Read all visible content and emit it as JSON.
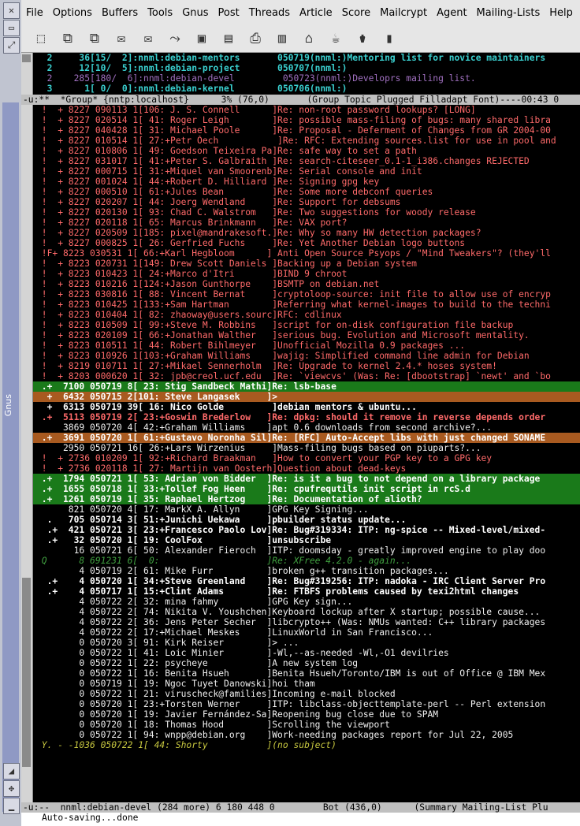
{
  "menubar": {
    "items": [
      "File",
      "Options",
      "Buffers",
      "Tools",
      "Gnus",
      "Post",
      "Threads",
      "Article",
      "Score",
      "Mailcrypt",
      "Agent",
      "Mailing-Lists",
      "Help"
    ]
  },
  "window_title": "Gnus",
  "toolbar": {
    "icons": [
      "exit-icon",
      "catch-up-icon",
      "catch-up-all-icon",
      "post-icon",
      "reply-icon",
      "forward-icon",
      "save-icon",
      "uudecode-icon",
      "print-icon",
      "copy-icon",
      "mark-icon",
      "kill-icon",
      "trash-icon",
      "prev-icon"
    ]
  },
  "group_buffer": {
    "lines": [
      {
        "text": "  2     36[15/  2]:nnml:debian-mentors       050719(nnml:)Mentoring list for novice maintainers",
        "style": "g-cyan",
        "marker": ""
      },
      {
        "text": "  2     12[10/  5]:nnml:debian-project       050707(nnml:)",
        "style": "g-cyan",
        "marker": ""
      },
      {
        "text": "  2    285[180/  6]:nnml:debian-devel         050723(nnml:)Developrs mailing list.",
        "style": "g-purple",
        "marker": "[]"
      },
      {
        "text": "  3      1[ 0/  0]:nnml:debian-kernel        050706(nnml:)",
        "style": "g-cyan",
        "marker": ""
      }
    ],
    "modeline": "-u:**  *Group* {nntp:localhost}      3% (76,0)       (Group Topic Plugged Filladapt Font)----00:43 0"
  },
  "summary_buffer": {
    "lines": [
      {
        "t": " !  + 8227 090113 1[106: J. S. Connell      ]Re: non-root password lookups? [LONG]",
        "s": "c-red"
      },
      {
        "t": " !  + 8227 020514 1[ 41: Roger Leigh        ]Re: possible mass-filing of bugs: many shared libra",
        "s": "c-red"
      },
      {
        "t": " !  + 8227 040428 1[ 31: Michael Poole      ]Re: Proposal - Deferment of Changes from GR 2004-00",
        "s": "c-red"
      },
      {
        "t": " !  + 8227 010514 1[ 27:+Petr Ŏech           ]Re: RFC: Extending sources.list for use in pool and",
        "s": "c-red"
      },
      {
        "t": " !  + 8227 010806 1[ 49: Goedson Teixeira Pa]Re: safe way to set a path",
        "s": "c-red"
      },
      {
        "t": " !  + 8227 031017 1[ 41:+Peter S. Galbraith ]Re: search-citeseer_0.1-1_i386.changes REJECTED",
        "s": "c-red"
      },
      {
        "t": " !  + 8227 000715 1[ 31:+Miquel van Smoorenb]Re: Serial console and init",
        "s": "c-red"
      },
      {
        "t": " !  + 8227 001024 1[ 44:+Robert D. Hilliard ]Re: Signing gpg key",
        "s": "c-red"
      },
      {
        "t": " !  + 8227 000510 1[ 61:+Jules Bean         ]Re: Some more debconf queries",
        "s": "c-red"
      },
      {
        "t": " !  + 8227 020207 1[ 44: Joerg Wendland     ]Re: Support for debsums",
        "s": "c-red"
      },
      {
        "t": " !  + 8227 020130 1[ 93: Chad C. Walstrom   ]Re: Two suggestions for woody release",
        "s": "c-red"
      },
      {
        "t": " !  + 8227 020118 1[ 65: Marcus Brinkmann   ]Re: VAX port?",
        "s": "c-red"
      },
      {
        "t": " !  + 8227 020509 1[185: pixel@mandrakesoft.]Re: Why so many HW detection packages?",
        "s": "c-red"
      },
      {
        "t": " !  + 8227 000825 1[ 26: Gerfried Fuchs     ]Re: Yet Another Debian logo buttons",
        "s": "c-red"
      },
      {
        "t": " !F+ 8223 030531 1[ 66:+Karl Hegbloom      ] Anti Open Source Psyops / \"Mind Tweakers\"? (they'll",
        "s": "c-red"
      },
      {
        "t": " !  + 8223 020731 1[149: Drew Scott Daniels ]Backing up a Debian system",
        "s": "c-red"
      },
      {
        "t": " !  + 8223 010423 1[ 24:+Marco d'Itri       ]BIND 9 chroot",
        "s": "c-red"
      },
      {
        "t": " !  + 8223 010216 1[124:+Jason Gunthorpe    ]BSMTP on debian.net",
        "s": "c-red"
      },
      {
        "t": " !  + 8223 030816 1[ 88: Vincent Bernat     ]cryptoloop-source: init file to allow use of encryp",
        "s": "c-red"
      },
      {
        "t": " !  + 8223 010425 1[133:+Sam Hartman        ]Referring what kernel-images to build to the techni",
        "s": "c-red"
      },
      {
        "t": " !  + 8223 010404 1[ 82: zhaoway@users.sourc]RFC: cdlinux",
        "s": "c-red"
      },
      {
        "t": " !  + 8223 010509 1[ 99:+Steve M. Robbins   ]script for on-disk configuration file backup",
        "s": "c-red"
      },
      {
        "t": " !  + 8223 020109 1[ 66:+Jonathan Walther   ]serious bug. Evolution and Microsoft mentality.",
        "s": "c-red"
      },
      {
        "t": " !  + 8223 010511 1[ 44: Robert Bihlmeyer   ]Unofficial Mozilla 0.9 packages ...",
        "s": "c-red"
      },
      {
        "t": " !  + 8223 010926 1[103:+Graham Williams    ]wajig: Simplified command line admin for Debian",
        "s": "c-red"
      },
      {
        "t": " !  + 8219 010711 1[ 27:+Mikael Sennerholm  ]Re: Upgrade to kernel 2.4.* hoses system!",
        "s": "c-red"
      },
      {
        "t": " !  + 8203 000620 1[ 32: jpb@creol.ucf.edu  ]Re: `viewcvs' (Was: Re: [dbootstrap] `newt' and `bo",
        "s": "c-red"
      },
      {
        "t": " .+  7100 050719 8[ 23: Stig Sandbeck Mathi]Re: lsb-base",
        "s": "hl-green"
      },
      {
        "t": "  +  6432 050715 2[101: Steve Langasek     ]>",
        "s": "hl-orange"
      },
      {
        "t": "  +  6313 050719 39[ 16: Nico Golde         ]debian mentors & ubuntu...",
        "s": "c-whitebold"
      },
      {
        "t": " .+  5113 050719 2[ 23:+Goswin Brederlow   ]Re: dpkg: should it remove in reverse depends order",
        "s": "c-bold"
      },
      {
        "t": "     3869 050720 4[ 42:+Graham Williams    ]apt 0.6 downloads from second archive?...",
        "s": "c-white"
      },
      {
        "t": " .+  3691 050720 1[ 61:+Gustavo Noronha Sil]Re: [RFC] Auto-Accept libs with just changed SONAME",
        "s": "hl-orange"
      },
      {
        "t": "     2950 050721 16[ 26:+Lars Wirzenius     ]Mass-filing bugs based on piuparts?...",
        "s": "c-white"
      },
      {
        "t": " !  + 2736 010209 1[ 92:+Richard Braakman   ]How to convert your PGP key to a GPG key",
        "s": "c-red"
      },
      {
        "t": " !  + 2736 020118 1[ 27: Martijn van Oosterh]Question about dead-keys",
        "s": "c-red"
      },
      {
        "t": " .+  1794 050721 1[ 53: Adrian von Bidder  ]Re: is it a bug to not depend on a library package",
        "s": "hl-green"
      },
      {
        "t": " .+  1655 050718 1[ 33:+Tollef Fog Heen    ]Re: cpufrequtils init script in rcS.d",
        "s": "hl-green"
      },
      {
        "t": " .+  1261 050719 1[ 35: Raphael Hertzog    ]Re: Documentation of alioth?",
        "s": "hl-green"
      },
      {
        "t": "      821 050720 4[ 17: MarkX A. Allyn     ]GPG Key Signing...",
        "s": "c-white"
      },
      {
        "t": "  .   705 050714 3[ 51:+Junichi Uekawa     ]pbuilder status update...",
        "s": "c-whitebold"
      },
      {
        "t": "  .+  421 050721 3[ 23:+Francesco Paolo Lov]Re: Bug#319334: ITP: ng-spice -- Mixed-level/mixed-",
        "s": "c-whitebold"
      },
      {
        "t": "  .+   32 050720 1[ 19: CoolFox            ]unsubscribe",
        "s": "c-whitebold"
      },
      {
        "t": "       16 050721 6[ 50: Alexander Fieroch  ]ITP: doomsday - greatly improved engine to play doo",
        "s": "c-white"
      },
      {
        "t": " Q      8 691231 6[  0:                    ]Re: XFree 4.2.0 - again...",
        "s": "c-greenital"
      },
      {
        "t": "        4 050719 2[ 61: Mike Furr          ]broken g++ transition packages...",
        "s": "c-white"
      },
      {
        "t": "  .+    4 050720 1[ 34:+Steve Greenland    ]Re: Bug#319256: ITP: nadoka - IRC Client Server Pro",
        "s": "c-whitebold"
      },
      {
        "t": "  .+    4 050717 1[ 15:+Clint Adams        ]Re: FTBFS problems caused by texi2html changes",
        "s": "c-whitebold"
      },
      {
        "t": "        4 050722 2[ 32: mina fahmy         ]GPG Key sign...",
        "s": "c-white"
      },
      {
        "t": "        4 050722 2[ 74: Nikita V. Youshchen]Keyboard lockup after X startup; possible cause...",
        "s": "c-white"
      },
      {
        "t": "        4 050722 2[ 36: Jens Peter Secher  ]libcrypto++ (Was: NMUs wanted: C++ library packages",
        "s": "c-white"
      },
      {
        "t": "        4 050722 2[ 17:+Michael Meskes     ]LinuxWorld in San Francisco...",
        "s": "c-white"
      },
      {
        "t": "        0 050720 3[ 91: Kirk Reiser        ]> ...",
        "s": "c-white"
      },
      {
        "t": "        0 050722 1[ 41: Loic Minier        ]-Wl,--as-needed -Wl,-O1 devilries",
        "s": "c-white"
      },
      {
        "t": "        0 050722 1[ 22: psycheye           ]A new system log",
        "s": "c-white"
      },
      {
        "t": "        0 050722 1[ 16: Benita Hsueh       ]Benita Hsueh/Toronto/IBM is out of Office @ IBM Mex",
        "s": "c-white"
      },
      {
        "t": "        0 050719 1[ 19: Ngoc Tuyet Danowski]hoi tham",
        "s": "c-white"
      },
      {
        "t": "        0 050722 1[ 21: viruscheck@families]Incoming e-mail blocked",
        "s": "c-white"
      },
      {
        "t": "        0 050720 1[ 23:+Torsten Werner     ]ITP: libclass-objecttemplate-perl -- Perl extension",
        "s": "c-white"
      },
      {
        "t": "        0 050720 1[ 19: Javier Fernández-Sa]Reopening bug close due to SPAM",
        "s": "c-white"
      },
      {
        "t": "        0 050720 1[ 18: Thomas Hood        ]Scrolling the viewport",
        "s": "c-white"
      },
      {
        "t": "        0 050722 1[ 94: wnpp@debian.org    ]Work-needing packages report for Jul 22, 2005",
        "s": "c-white"
      },
      {
        "t": " Y. - -1036 050722 1[ 44: Shorty           ](no subject)",
        "s": "c-yellowital"
      }
    ],
    "modeline": "-u:--  nnml:debian-devel (284 more) 6 180 448 0         Bot (436,0)      (Summary Mailing-List Plu"
  },
  "minibuffer": "Auto-saving...done"
}
